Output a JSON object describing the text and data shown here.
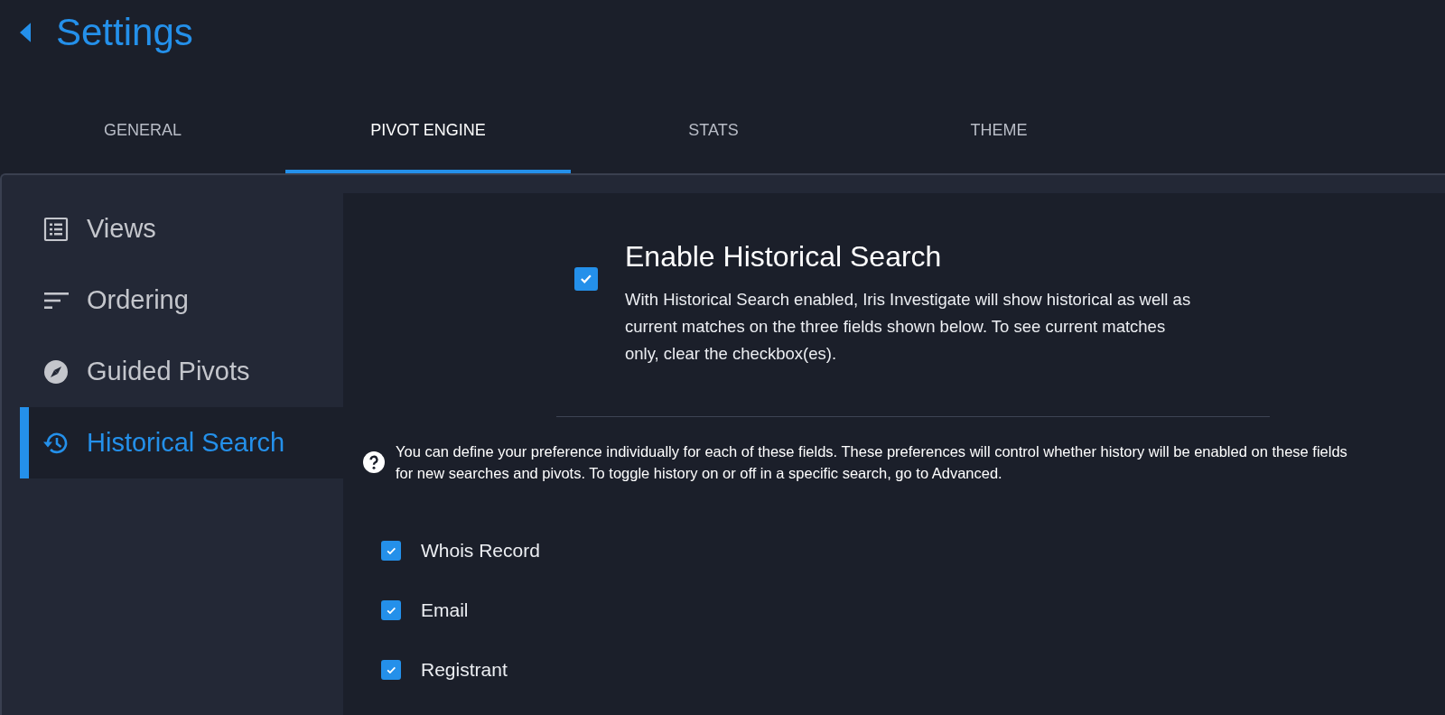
{
  "header": {
    "title": "Settings"
  },
  "tabs": [
    {
      "label": "GENERAL",
      "selected": false
    },
    {
      "label": "PIVOT ENGINE",
      "selected": true
    },
    {
      "label": "STATS",
      "selected": false
    },
    {
      "label": "THEME",
      "selected": false
    }
  ],
  "sidebar": {
    "items": [
      {
        "label": "Views",
        "kind": "list",
        "selected": false
      },
      {
        "label": "Ordering",
        "kind": "sort",
        "selected": false
      },
      {
        "label": "Guided Pivots",
        "kind": "compass",
        "selected": false
      },
      {
        "label": "Historical Search",
        "kind": "history",
        "selected": true
      }
    ]
  },
  "main": {
    "enable": {
      "title": "Enable Historical Search",
      "checked": true,
      "description": "With Historical Search enabled, Iris Investigate will show historical as well as current matches on the three fields shown below. To see current matches only, clear the checkbox(es)."
    },
    "help": "You can define your preference individually for each of these fields. These preferences will control whether history will be enabled on these fields for new searches and pivots. To toggle history on or off in a specific search, go to Advanced.",
    "fields": [
      {
        "label": "Whois Record",
        "checked": true
      },
      {
        "label": "Email",
        "checked": true
      },
      {
        "label": "Registrant",
        "checked": true
      }
    ]
  }
}
